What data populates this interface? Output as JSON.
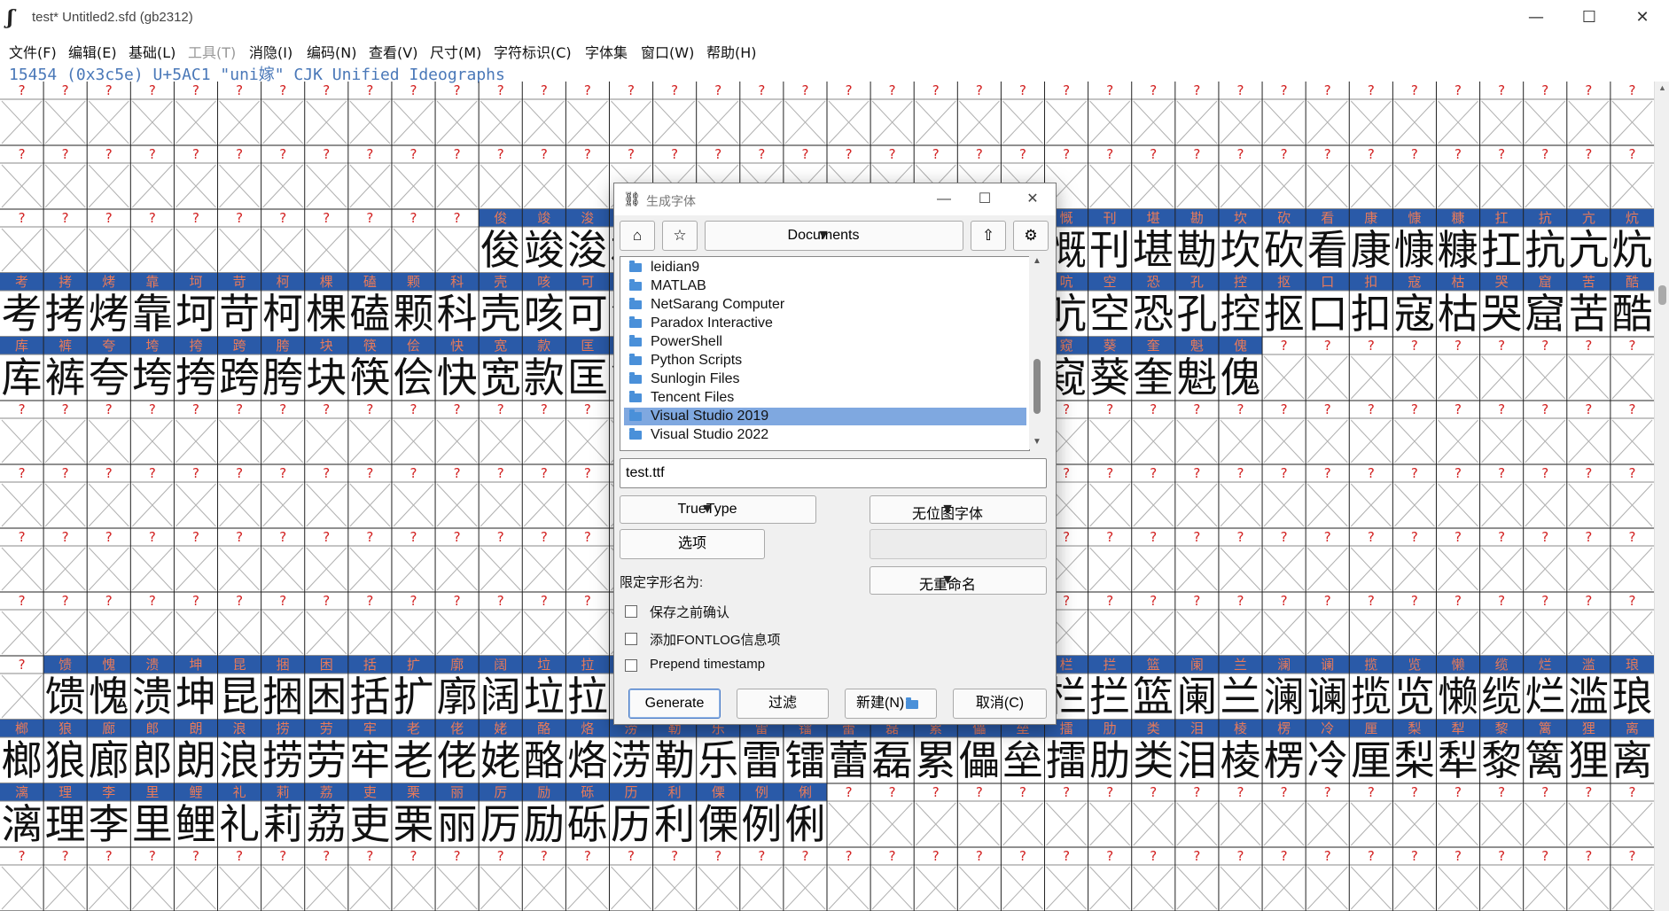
{
  "window": {
    "title": "test*  Untitled2.sfd (gb2312)",
    "app_icon": "ʃ",
    "controls": {
      "minimize": "—",
      "maximize": "☐",
      "close": "✕"
    }
  },
  "menu": [
    {
      "label": "文件(F)",
      "enabled": true
    },
    {
      "label": "编辑(E)",
      "enabled": true
    },
    {
      "label": "基础(L)",
      "enabled": true
    },
    {
      "label": "工具(T)",
      "enabled": false
    },
    {
      "label": "消隐(I)",
      "enabled": true
    },
    {
      "label": "编码(N)",
      "enabled": true
    },
    {
      "label": "查看(V)",
      "enabled": true
    },
    {
      "label": "尺寸(M)",
      "enabled": true
    },
    {
      "label": "字符标识(C)",
      "enabled": true
    },
    {
      "label": "字体集",
      "enabled": true
    },
    {
      "label": "窗口(W)",
      "enabled": true
    },
    {
      "label": "帮助(H)",
      "enabled": true
    }
  ],
  "info_line": "15454 (0x3c5e) U+5AC1 \"uni嫁\" CJK Unified Ideographs",
  "glyph_grid": {
    "columns": 38,
    "missing_label": "?",
    "colors": {
      "header_bg": "#2a5aa8",
      "header_text": "#e87a5a",
      "missing_q": "#d22222",
      "grid_line": "#222222"
    },
    "rows": [
      {
        "glyphs": ""
      },
      {
        "glyphs": ""
      },
      {
        "start": 11,
        "glyphs": "俊竣浚郡骏喀咖卡咯开揩楷凯慨刊堪勘坎砍看康慷糠扛抗亢炕"
      },
      {
        "glyphs": "考拷烤靠坷苛柯棵磕颗科壳咳可渴克刻客课肯啃垦恳坑吭空恐孔控抠口扣寇枯哭窟苦酷"
      },
      {
        "glyphs": "库裤夸垮挎跨胯块筷侩快宽款匡筐狂框矿眶旷况亏盔岿窥葵奎魁傀"
      },
      {
        "glyphs": ""
      },
      {
        "glyphs": ""
      },
      {
        "glyphs": ""
      },
      {
        "glyphs": ""
      },
      {
        "start": 1,
        "glyphs": "馈愧溃坤昆捆困括扩廓阔垃拉喇蜡腊辣啦莱来赖蓝婪栏拦篮阑兰澜谰揽览懒缆烂滥琅"
      },
      {
        "glyphs": "榔狼廊郎朗浪捞劳牢老佬姥酪烙涝勒乐雷镭蕾磊累儡垒擂肋类泪棱楞冷厘梨犁黎篱狸离"
      },
      {
        "glyphs": "漓理李里鲤礼莉荔吏栗丽厉励砾历利傈例俐"
      },
      {
        "glyphs": ""
      }
    ]
  },
  "dialog": {
    "title": "生成字体",
    "icon": "⛓",
    "path": "Documents",
    "toolbar": {
      "home": "⌂",
      "bookmark": "☆",
      "up": "⇧",
      "settings": "⚙"
    },
    "folders": [
      "leidian9",
      "MATLAB",
      "NetSarang Computer",
      "Paradox Interactive",
      "PowerShell",
      "Python Scripts",
      "Sunlogin Files",
      "Tencent Files",
      "Visual Studio 2019",
      "Visual Studio 2022"
    ],
    "selected_folder": "Visual Studio 2019",
    "filename": "test.ttf",
    "format": "TrueType",
    "bitmap": "无位图字体",
    "options_button": "选项",
    "limit_label": "限定字形名为:",
    "rename": "无重命名",
    "checkboxes": [
      {
        "label": "保存之前确认",
        "checked": false
      },
      {
        "label": "添加FONTLOG信息项",
        "checked": false
      },
      {
        "label": "Prepend timestamp",
        "checked": false
      }
    ],
    "buttons": {
      "generate": "Generate",
      "filter": "过滤",
      "new": "新建(N)",
      "cancel": "取消(C)"
    }
  }
}
